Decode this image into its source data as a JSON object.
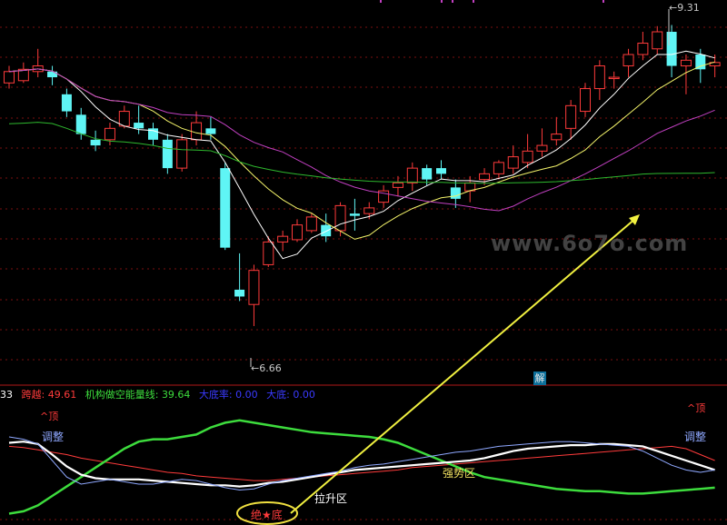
{
  "watermark": "www.6o7o.com",
  "price_markers": {
    "high": "9.31",
    "low": "6.66"
  },
  "jie_badge": "解",
  "indicator_header": {
    "prefix": "33",
    "items": [
      {
        "label": "跨越:",
        "value": "49.61",
        "color": "#ff3b3b"
      },
      {
        "label": "机构做空能量线:",
        "value": "39.64",
        "color": "#3ddc3d"
      },
      {
        "label": "大底率:",
        "value": "0.00",
        "color": "#3a3aff"
      },
      {
        "label": "大底:",
        "value": "0.00",
        "color": "#3a3aff"
      }
    ]
  },
  "annotations": {
    "top_left": "顶",
    "top_right": "顶",
    "adjust_left": "调整",
    "adjust_right": "调整",
    "strong_zone": "强势区",
    "rise_zone": "拉升区",
    "bottom": "绝★底"
  },
  "colors": {
    "up": "#ff3b3b",
    "down": "#5ff5f5",
    "ma_white": "#ffffff",
    "ma_yellow": "#f3f36a",
    "ma_magenta": "#c040c0",
    "ma_green": "#2eb82e",
    "grid": "#7a1010",
    "arrow": "#f0f040"
  },
  "chart_data": [
    {
      "type": "candlestick",
      "title": "",
      "price_range": [
        6.3,
        9.45
      ],
      "high_label": 9.31,
      "low_label": 6.66,
      "candles": [
        [
          8.8,
          8.9,
          8.95,
          8.75
        ],
        [
          8.82,
          8.92,
          8.98,
          8.8
        ],
        [
          8.9,
          8.95,
          9.1,
          8.85
        ],
        [
          8.9,
          8.85,
          8.95,
          8.78
        ],
        [
          8.7,
          8.55,
          8.75,
          8.5
        ],
        [
          8.52,
          8.35,
          8.58,
          8.3
        ],
        [
          8.3,
          8.25,
          8.38,
          8.2
        ],
        [
          8.3,
          8.4,
          8.45,
          8.25
        ],
        [
          8.42,
          8.55,
          8.6,
          8.4
        ],
        [
          8.45,
          8.4,
          8.6,
          8.35
        ],
        [
          8.4,
          8.3,
          8.45,
          8.25
        ],
        [
          8.3,
          8.05,
          8.35,
          8.0
        ],
        [
          8.05,
          8.3,
          8.35,
          8.02
        ],
        [
          8.3,
          8.45,
          8.55,
          8.25
        ],
        [
          8.4,
          8.35,
          8.5,
          8.3
        ],
        [
          8.05,
          7.35,
          8.1,
          7.33
        ],
        [
          6.98,
          6.92,
          7.3,
          6.88
        ],
        [
          6.85,
          7.15,
          7.2,
          6.66
        ],
        [
          7.2,
          7.4,
          7.45,
          7.18
        ],
        [
          7.4,
          7.45,
          7.5,
          7.32
        ],
        [
          7.42,
          7.55,
          7.6,
          7.4
        ],
        [
          7.5,
          7.62,
          7.65,
          7.48
        ],
        [
          7.55,
          7.45,
          7.65,
          7.4
        ],
        [
          7.5,
          7.72,
          7.75,
          7.45
        ],
        [
          7.65,
          7.63,
          7.78,
          7.5
        ],
        [
          7.65,
          7.7,
          7.75,
          7.6
        ],
        [
          7.75,
          7.85,
          7.9,
          7.7
        ],
        [
          7.88,
          7.92,
          7.98,
          7.8
        ],
        [
          7.92,
          8.05,
          8.1,
          7.85
        ],
        [
          8.05,
          7.95,
          8.08,
          7.9
        ],
        [
          8.05,
          8.0,
          8.12,
          7.95
        ],
        [
          7.88,
          7.78,
          7.95,
          7.7
        ],
        [
          7.85,
          7.92,
          7.98,
          7.75
        ],
        [
          7.95,
          8.0,
          8.05,
          7.9
        ],
        [
          8.0,
          8.1,
          8.12,
          7.95
        ],
        [
          8.05,
          8.15,
          8.25,
          8.0
        ],
        [
          8.1,
          8.2,
          8.35,
          8.05
        ],
        [
          8.2,
          8.25,
          8.4,
          8.15
        ],
        [
          8.3,
          8.35,
          8.5,
          8.25
        ],
        [
          8.4,
          8.6,
          8.65,
          8.3
        ],
        [
          8.55,
          8.75,
          8.8,
          8.5
        ],
        [
          8.75,
          8.95,
          9.0,
          8.65
        ],
        [
          8.85,
          8.85,
          8.9,
          8.75
        ],
        [
          8.95,
          9.05,
          9.1,
          8.85
        ],
        [
          9.05,
          9.15,
          9.25,
          9.0
        ],
        [
          9.1,
          9.25,
          9.3,
          9.05
        ],
        [
          9.25,
          8.95,
          9.31,
          8.85
        ],
        [
          8.95,
          9.0,
          9.05,
          8.7
        ],
        [
          9.05,
          8.92,
          9.1,
          8.8
        ],
        [
          8.95,
          8.98,
          9.05,
          8.85
        ]
      ]
    },
    {
      "type": "line",
      "title": "",
      "x_count": 50,
      "yrange": [
        0,
        100
      ],
      "series": [
        {
          "name": "跨越",
          "color": "#ff3b3b",
          "values": [
            62,
            61,
            59,
            57,
            55,
            52,
            50,
            48,
            46,
            44,
            42,
            40,
            39,
            37,
            36,
            35,
            34,
            33,
            33,
            34,
            35,
            36,
            37,
            38,
            39,
            40,
            41,
            42,
            44,
            45,
            46,
            47,
            48,
            49,
            50,
            51,
            52,
            53,
            54,
            55,
            56,
            57,
            58,
            59,
            60,
            61,
            62,
            60,
            55,
            50
          ]
        },
        {
          "name": "机构做空能量线",
          "color": "#3ddc3d",
          "values": [
            5,
            7,
            12,
            20,
            28,
            36,
            44,
            52,
            60,
            66,
            68,
            68,
            70,
            72,
            78,
            82,
            84,
            82,
            80,
            78,
            76,
            74,
            73,
            72,
            71,
            70,
            68,
            65,
            60,
            55,
            50,
            45,
            40,
            36,
            34,
            32,
            30,
            28,
            26,
            25,
            24,
            24,
            23,
            22,
            22,
            23,
            24,
            25,
            26,
            27
          ]
        },
        {
          "name": "",
          "color": "#ffffff",
          "values": [
            65,
            66,
            64,
            55,
            45,
            38,
            35,
            34,
            34,
            34,
            33,
            32,
            31,
            30,
            29,
            29,
            28,
            29,
            31,
            32,
            34,
            36,
            38,
            40,
            42,
            43,
            44,
            45,
            46,
            47,
            48,
            49,
            50,
            52,
            55,
            58,
            60,
            61,
            62,
            63,
            63,
            64,
            64,
            63,
            62,
            58,
            54,
            50,
            46,
            42
          ]
        },
        {
          "name": "",
          "color": "#8fa8ff",
          "values": [
            70,
            68,
            64,
            50,
            36,
            30,
            32,
            34,
            32,
            30,
            30,
            32,
            34,
            33,
            30,
            27,
            25,
            26,
            30,
            33,
            35,
            37,
            39,
            41,
            44,
            46,
            47,
            49,
            51,
            53,
            55,
            57,
            58,
            60,
            62,
            63,
            64,
            65,
            66,
            66,
            65,
            64,
            63,
            62,
            58,
            52,
            46,
            42,
            40,
            42
          ]
        }
      ]
    }
  ]
}
